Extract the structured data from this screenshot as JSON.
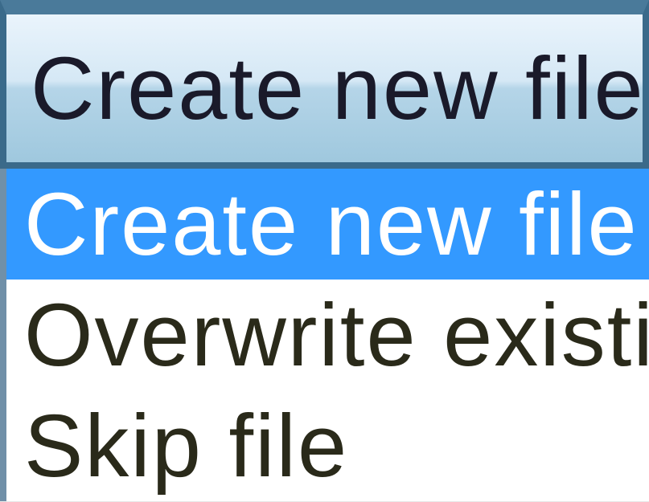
{
  "dropdown": {
    "selected_label": "Create new file",
    "options": [
      {
        "label": "Create new file",
        "selected": true
      },
      {
        "label": "Overwrite existing file",
        "selected": false
      },
      {
        "label": "Skip file",
        "selected": false
      }
    ]
  }
}
